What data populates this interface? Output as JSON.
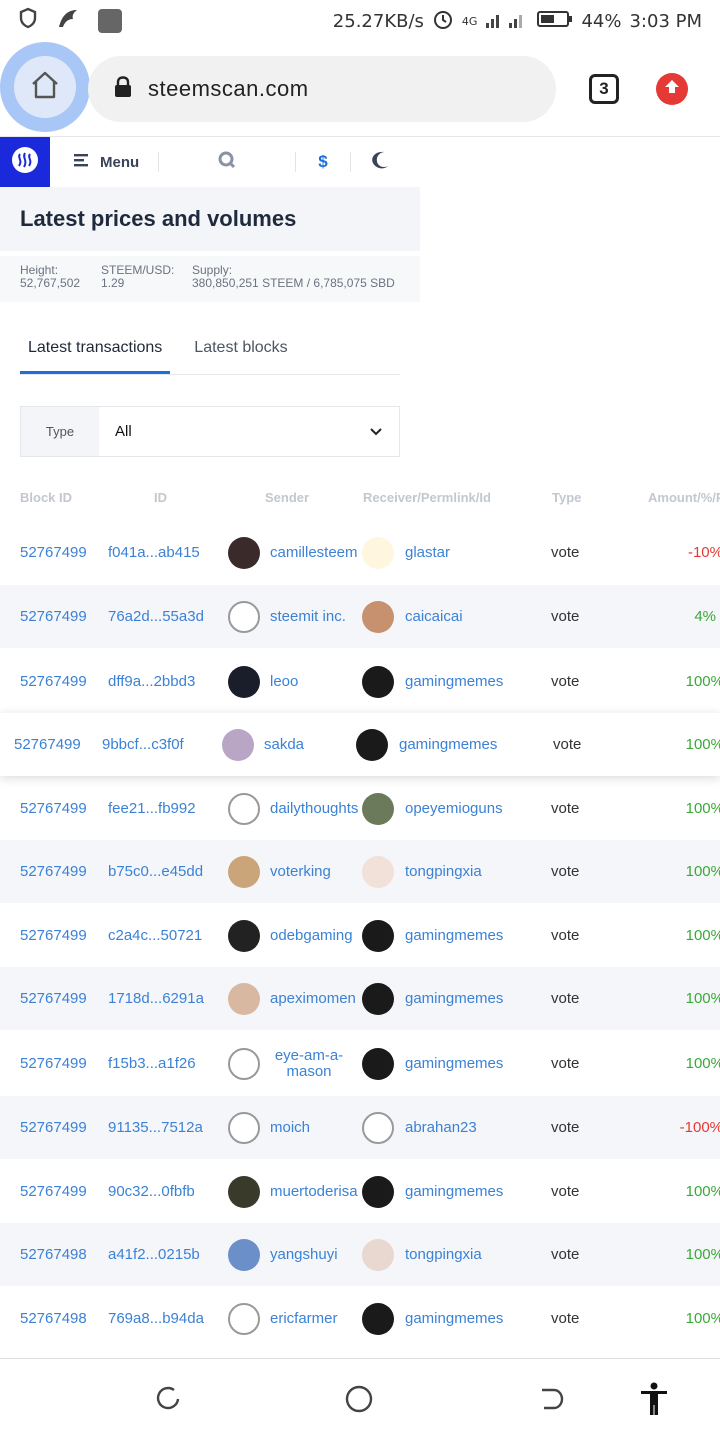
{
  "status_bar": {
    "speed": "25.27KB/s",
    "network": "4G",
    "battery": "44%",
    "time": "3:03 PM",
    "icons": [
      "shield-icon",
      "bird-icon",
      "app-square-icon",
      "alarm-icon",
      "signal-icon",
      "battery-icon"
    ]
  },
  "browser": {
    "url": "steemscan.com",
    "tab_count": "3",
    "accent": "#a9c7f6",
    "upload_color": "#e53935"
  },
  "header": {
    "menu_label": "Menu",
    "logo_color": "#1a2adb"
  },
  "page": {
    "title": "Latest prices and volumes",
    "info": [
      {
        "label": "Height:",
        "value": "52,767,502"
      },
      {
        "label": "STEEM/USD:",
        "value": "1.29"
      },
      {
        "label": "Supply:",
        "value": "380,850,251 STEEM / 6,785,075 SBD"
      }
    ],
    "tabs": [
      "Latest transactions",
      "Latest blocks"
    ],
    "filter": {
      "label": "Type",
      "value": "All"
    }
  },
  "table": {
    "columns": [
      "Block ID",
      "ID",
      "Sender",
      "Receiver/Permlink/Id",
      "Type",
      "Amount/%/P"
    ],
    "rows": [
      {
        "block": "52767499",
        "id": "f041a...ab415",
        "sender": "camillesteem",
        "receiver": "glastar",
        "type": "vote",
        "amount": "-10%"
      },
      {
        "block": "52767499",
        "id": "76a2d...55a3d",
        "sender": "steemit inc.",
        "receiver": "caicaicai",
        "type": "vote",
        "amount": "4%"
      },
      {
        "block": "52767499",
        "id": "dff9a...2bbd3",
        "sender": "leoo",
        "receiver": "gamingmemes",
        "type": "vote",
        "amount": "100%"
      },
      {
        "block": "52767499",
        "id": "9bbcf...c3f0f",
        "sender": "sakda",
        "receiver": "gamingmemes",
        "type": "vote",
        "amount": "100%"
      },
      {
        "block": "52767499",
        "id": "fee21...fb992",
        "sender": "dailythoughts",
        "receiver": "opeyemioguns",
        "type": "vote",
        "amount": "100%"
      },
      {
        "block": "52767499",
        "id": "b75c0...e45dd",
        "sender": "voterking",
        "receiver": "tongpingxia",
        "type": "vote",
        "amount": "100%"
      },
      {
        "block": "52767499",
        "id": "c2a4c...50721",
        "sender": "odebgaming",
        "receiver": "gamingmemes",
        "type": "vote",
        "amount": "100%"
      },
      {
        "block": "52767499",
        "id": "1718d...6291a",
        "sender": "apeximomen",
        "receiver": "gamingmemes",
        "type": "vote",
        "amount": "100%"
      },
      {
        "block": "52767499",
        "id": "f15b3...a1f26",
        "sender": "eye-am-a-mason",
        "receiver": "gamingmemes",
        "type": "vote",
        "amount": "100%"
      },
      {
        "block": "52767499",
        "id": "91135...7512a",
        "sender": "moich",
        "receiver": "abrahan23",
        "type": "vote",
        "amount": "-100%"
      },
      {
        "block": "52767499",
        "id": "90c32...0fbfb",
        "sender": "muertoderisa",
        "receiver": "gamingmemes",
        "type": "vote",
        "amount": "100%"
      },
      {
        "block": "52767498",
        "id": "a41f2...0215b",
        "sender": "yangshuyi",
        "receiver": "tongpingxia",
        "type": "vote",
        "amount": "100%"
      },
      {
        "block": "52767498",
        "id": "769a8...b94da",
        "sender": "ericfarmer",
        "receiver": "gamingmemes",
        "type": "vote",
        "amount": "100%"
      }
    ]
  },
  "colors": {
    "link": "#3b82d6",
    "positive": "#3aa935",
    "negative": "#e53935"
  }
}
